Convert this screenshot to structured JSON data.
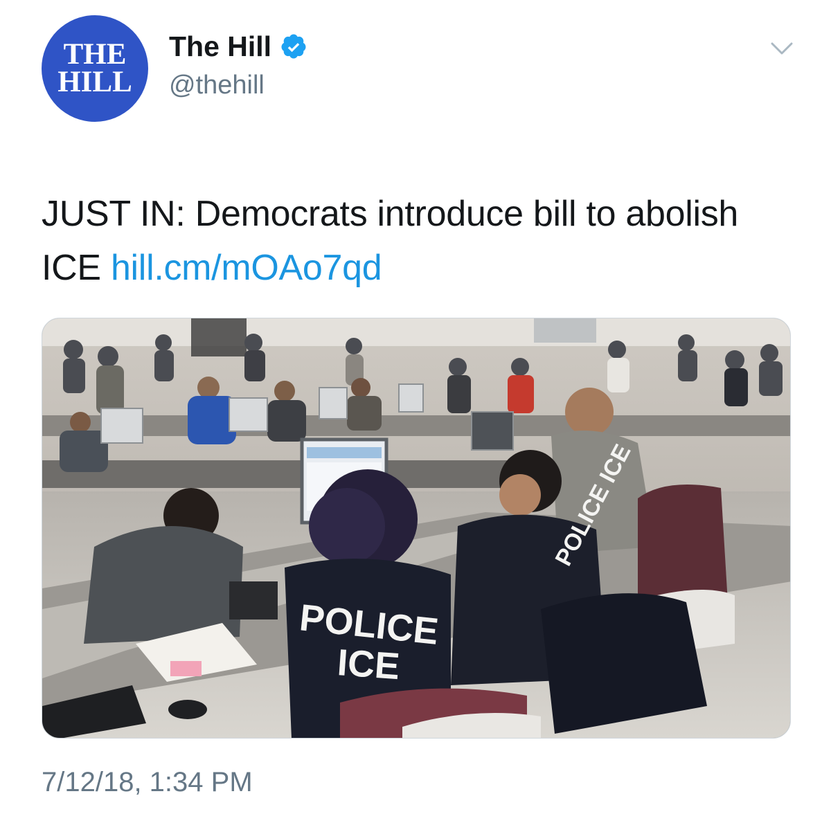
{
  "author": {
    "avatar_line1": "THE",
    "avatar_line2": "HILL",
    "display_name": "The Hill",
    "handle": "@thehill",
    "verified": true
  },
  "tweet": {
    "text_main": "JUST IN: Democrats introduce bill to abolish ICE ",
    "link_text": "hill.cm/mOAo7qd",
    "timestamp": "7/12/18, 1:34 PM"
  },
  "media": {
    "vest_text_line1": "POLICE",
    "vest_text_line2": "ICE",
    "vest_text_side": "POLICE ICE"
  },
  "icons": {
    "verified": "verified-badge-icon",
    "menu": "chevron-down-icon"
  },
  "colors": {
    "avatar_bg": "#2f54c6",
    "link": "#1b95e0",
    "secondary_text": "#657786",
    "verified": "#1da1f2"
  }
}
